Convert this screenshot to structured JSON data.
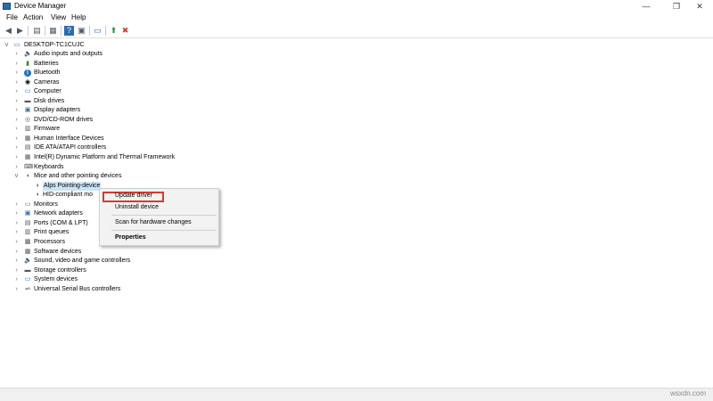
{
  "window": {
    "title": "Device Manager",
    "minimize": "—",
    "maximize": "❐",
    "close": "✕"
  },
  "menu": [
    "File",
    "Action",
    "View",
    "Help"
  ],
  "toolbar": [
    {
      "icon": "back-icon",
      "glyph": "◀"
    },
    {
      "icon": "forward-icon",
      "glyph": "▶"
    },
    {
      "icon": "show-hide-console-tree-icon",
      "glyph": "▤"
    },
    {
      "icon": "properties-icon",
      "glyph": "▦"
    },
    {
      "icon": "help-icon",
      "glyph": "?"
    },
    {
      "icon": "action-pane-icon",
      "glyph": "▣"
    },
    {
      "icon": "scan-hardware-icon",
      "glyph": "▭"
    },
    {
      "icon": "update-driver-icon",
      "glyph": "⬆"
    },
    {
      "icon": "uninstall-device-icon",
      "glyph": "✖"
    }
  ],
  "tree": {
    "root": "DESKTOP-TC1CUJC",
    "categories": [
      {
        "label": "Audio inputs and outputs",
        "icon": "speaker-icon",
        "glyph": "🔈"
      },
      {
        "label": "Batteries",
        "icon": "battery-icon",
        "glyph": "▮"
      },
      {
        "label": "Bluetooth",
        "icon": "bluetooth-icon",
        "glyph": "ᛒ"
      },
      {
        "label": "Cameras",
        "icon": "camera-icon",
        "glyph": "◉"
      },
      {
        "label": "Computer",
        "icon": "computer-icon",
        "glyph": "▭"
      },
      {
        "label": "Disk drives",
        "icon": "disk-drive-icon",
        "glyph": "▬"
      },
      {
        "label": "Display adapters",
        "icon": "display-adapter-icon",
        "glyph": "▣"
      },
      {
        "label": "DVD/CD-ROM drives",
        "icon": "dvd-drive-icon",
        "glyph": "◎"
      },
      {
        "label": "Firmware",
        "icon": "firmware-icon",
        "glyph": "▥"
      },
      {
        "label": "Human Interface Devices",
        "icon": "hid-icon",
        "glyph": "▦"
      },
      {
        "label": "IDE ATA/ATAPI controllers",
        "icon": "ide-controller-icon",
        "glyph": "▤"
      },
      {
        "label": "Intel(R) Dynamic Platform and Thermal Framework",
        "icon": "intel-dptf-icon",
        "glyph": "▦"
      },
      {
        "label": "Keyboards",
        "icon": "keyboard-icon",
        "glyph": "⌨"
      },
      {
        "label": "Mice and other pointing devices",
        "icon": "mouse-icon",
        "glyph": "◖",
        "expanded": true,
        "children": [
          {
            "label": "Alps Pointing-device",
            "icon": "mouse-icon",
            "glyph": "◖",
            "selected": true
          },
          {
            "label": "HID-compliant mo",
            "icon": "mouse-icon",
            "glyph": "◖"
          }
        ]
      },
      {
        "label": "Monitors",
        "icon": "monitor-icon",
        "glyph": "▭"
      },
      {
        "label": "Network adapters",
        "icon": "network-adapter-icon",
        "glyph": "▣"
      },
      {
        "label": "Ports (COM & LPT)",
        "icon": "port-icon",
        "glyph": "▤"
      },
      {
        "label": "Print queues",
        "icon": "printer-icon",
        "glyph": "▥"
      },
      {
        "label": "Processors",
        "icon": "processor-icon",
        "glyph": "▩"
      },
      {
        "label": "Software devices",
        "icon": "software-device-icon",
        "glyph": "▦"
      },
      {
        "label": "Sound, video and game controllers",
        "icon": "sound-controller-icon",
        "glyph": "🔈"
      },
      {
        "label": "Storage controllers",
        "icon": "storage-controller-icon",
        "glyph": "▬"
      },
      {
        "label": "System devices",
        "icon": "system-device-icon",
        "glyph": "▭"
      },
      {
        "label": "Universal Serial Bus controllers",
        "icon": "usb-controller-icon",
        "glyph": "⇌"
      }
    ]
  },
  "context_menu": {
    "items": [
      "Update driver",
      "Uninstall device",
      "Scan for hardware changes",
      "Properties"
    ],
    "highlighted": "Update driver"
  },
  "colors": {
    "highlight_border": "#d13c2f",
    "selection": "#cce4f7"
  },
  "watermark": "wsxdn.com"
}
